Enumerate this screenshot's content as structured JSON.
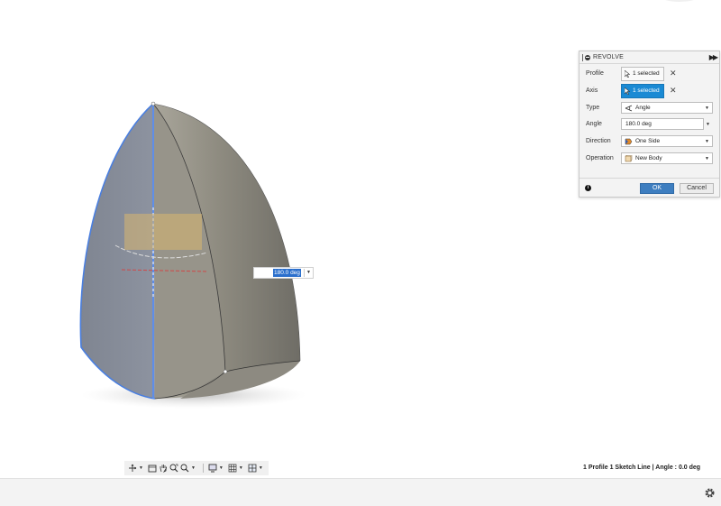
{
  "panel": {
    "title": "REVOLVE",
    "rows": {
      "profile": {
        "label": "Profile",
        "value": "1 selected"
      },
      "axis": {
        "label": "Axis",
        "value": "1 selected"
      },
      "type": {
        "label": "Type",
        "value": "Angle"
      },
      "angle": {
        "label": "Angle",
        "value": "180.0 deg"
      },
      "direction": {
        "label": "Direction",
        "value": "One Side"
      },
      "operation": {
        "label": "Operation",
        "value": "New Body"
      }
    },
    "ok_label": "OK",
    "cancel_label": "Cancel",
    "clear_glyph": "✕",
    "info_glyph": "i"
  },
  "canvas_input": {
    "value": "180.0 deg"
  },
  "status": "1 Profile 1 Sketch Line | Angle : 0.0 deg",
  "toolbar": {
    "icons": [
      "orbit-icon",
      "look-at-icon",
      "pan-icon",
      "zoom-icon",
      "fit-icon",
      "display-settings-icon",
      "grid-icon",
      "viewports-icon"
    ]
  },
  "colors": {
    "accent": "#1a8ad4",
    "ok_button": "#3e7ec0",
    "selection_edge": "#4a7fe0",
    "body_gray": "#8a8a86"
  }
}
